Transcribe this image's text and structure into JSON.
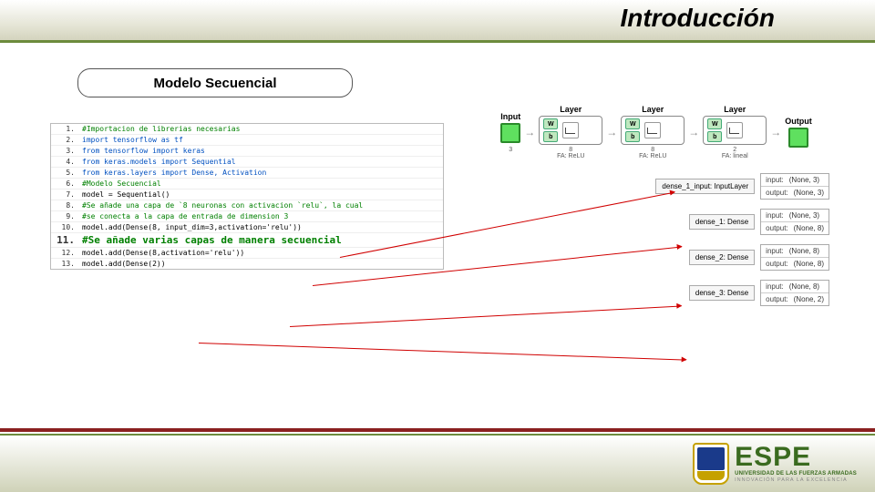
{
  "header": {
    "title": "Introducción"
  },
  "subtitle": "Modelo Secuencial",
  "code": {
    "lines": [
      {
        "n": "1.",
        "cls": "k-green",
        "t": "#Importacion de librerias necesarias"
      },
      {
        "n": "2.",
        "cls": "k-blue",
        "t": "import tensorflow as tf"
      },
      {
        "n": "3.",
        "cls": "k-blue",
        "t": "from tensorflow import keras"
      },
      {
        "n": "4.",
        "cls": "k-blue",
        "t": "from keras.models import Sequential"
      },
      {
        "n": "5.",
        "cls": "k-blue",
        "t": "from keras.layers import Dense, Activation"
      },
      {
        "n": "6.",
        "cls": "k-green",
        "t": "#Modelo Secuencial"
      },
      {
        "n": "7.",
        "cls": "k-black",
        "t": "model = Sequential()"
      },
      {
        "n": "8.",
        "cls": "k-green",
        "t": "#Se añade una capa de `8 neuronas con activacion `relu`, la cual"
      },
      {
        "n": "9.",
        "cls": "k-green",
        "t": "#se conecta a la capa de entrada de dimension 3"
      },
      {
        "n": "10.",
        "cls": "k-black",
        "t": "model.add(Dense(8, input_dim=3,activation='relu'))"
      },
      {
        "n": "11.",
        "cls": "k-green",
        "t": "#Se añade varias capas de manera secuencial",
        "big": true
      },
      {
        "n": "12.",
        "cls": "k-black",
        "t": "model.add(Dense(8,activation='relu'))"
      },
      {
        "n": "13.",
        "cls": "k-black",
        "t": "model.add(Dense(2))"
      }
    ]
  },
  "diagram": {
    "input_label": "Input",
    "output_label": "Output",
    "layers": [
      {
        "title": "Layer",
        "sub": "8\nFA: ReLU"
      },
      {
        "title": "Layer",
        "sub": "8\nFA: ReLU"
      },
      {
        "title": "Layer",
        "sub": "2\nFA: lineal"
      }
    ],
    "input_sub": "3",
    "wb": {
      "w": "W",
      "b": "b"
    },
    "info": [
      {
        "left": "dense_1_input: InputLayer",
        "rows": [
          {
            "k": "input:",
            "v": "(None, 3)"
          },
          {
            "k": "output:",
            "v": "(None, 3)"
          }
        ]
      },
      {
        "left": "dense_1: Dense",
        "rows": [
          {
            "k": "input:",
            "v": "(None, 3)"
          },
          {
            "k": "output:",
            "v": "(None, 8)"
          }
        ]
      },
      {
        "left": "dense_2: Dense",
        "rows": [
          {
            "k": "input:",
            "v": "(None, 8)"
          },
          {
            "k": "output:",
            "v": "(None, 8)"
          }
        ]
      },
      {
        "left": "dense_3: Dense",
        "rows": [
          {
            "k": "input:",
            "v": "(None, 8)"
          },
          {
            "k": "output:",
            "v": "(None, 2)"
          }
        ]
      }
    ]
  },
  "footer": {
    "brand": "ESPE",
    "line1": "UNIVERSIDAD DE LAS FUERZAS ARMADAS",
    "line2": "INNOVACIÓN  PARA  LA  EXCELENCIA"
  }
}
